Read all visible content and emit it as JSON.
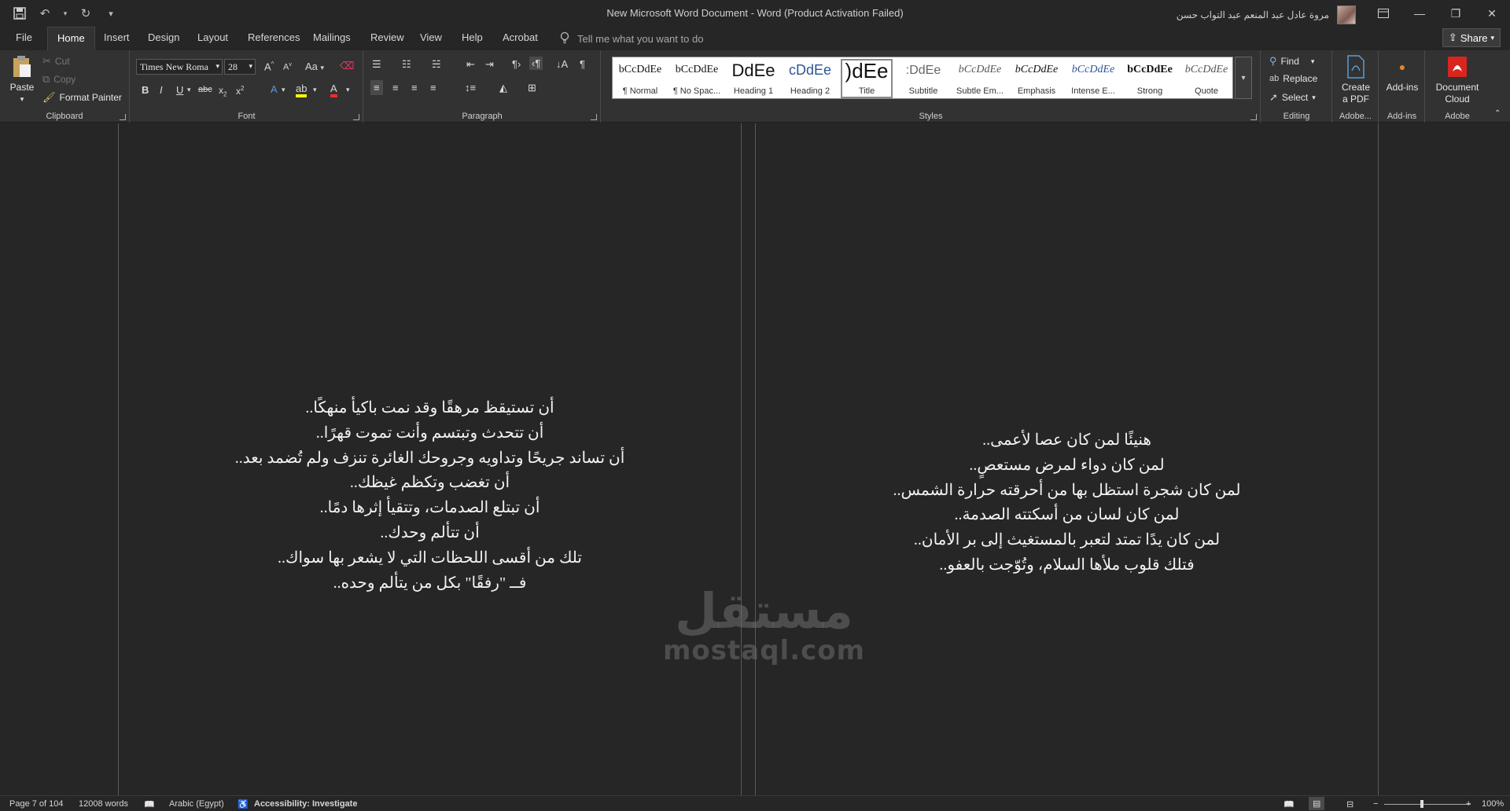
{
  "window": {
    "title": "New Microsoft Word Document  -  Word (Product Activation Failed)",
    "user_name": "مروة عادل عبد المنعم عبد التواب حسن"
  },
  "quick_access": {
    "save_icon": "save-icon",
    "undo_icon": "undo-icon",
    "redo_icon": "redo-icon",
    "customize_icon": "customize-icon"
  },
  "tabs": [
    "File",
    "Home",
    "Insert",
    "Design",
    "Layout",
    "References",
    "Mailings",
    "Review",
    "View",
    "Help",
    "Acrobat"
  ],
  "active_tab": "Home",
  "tell_me": "Tell me what you want to do",
  "share_label": "Share",
  "clipboard": {
    "paste": "Paste",
    "cut": "Cut",
    "copy": "Copy",
    "format_painter": "Format Painter",
    "label": "Clipboard"
  },
  "font": {
    "name": "Times New Roma",
    "size": "28",
    "change_case": "Aa",
    "label": "Font"
  },
  "paragraph": {
    "label": "Paragraph"
  },
  "styles": {
    "label": "Styles",
    "items": [
      {
        "preview": "bCcDdEe",
        "name": "¶ Normal"
      },
      {
        "preview": "bCcDdEe",
        "name": "¶ No Spac..."
      },
      {
        "preview": "DdEe",
        "name": "Heading 1"
      },
      {
        "preview": "cDdEe",
        "name": "Heading 2"
      },
      {
        "preview": ")dEe",
        "name": "Title"
      },
      {
        "preview": ":DdEe",
        "name": "Subtitle"
      },
      {
        "preview": "bCcDdEe",
        "name": "Subtle Em..."
      },
      {
        "preview": "bCcDdEe",
        "name": "Emphasis"
      },
      {
        "preview": "bCcDdEe",
        "name": "Intense E..."
      },
      {
        "preview": "bCcDdEe",
        "name": "Strong"
      },
      {
        "preview": "bCcDdEe",
        "name": "Quote"
      }
    ]
  },
  "editing": {
    "find": "Find",
    "replace": "Replace",
    "select": "Select",
    "label": "Editing"
  },
  "adobe": {
    "create_pdf_line1": "Create",
    "create_pdf_line2": "a PDF",
    "label": "Adobe..."
  },
  "addins": {
    "button": "Add-ins",
    "label": "Add-ins"
  },
  "doc_cloud": {
    "line1": "Document",
    "line2": "Cloud",
    "label": "Adobe"
  },
  "left_page": {
    "lines": [
      "أن تستيقظ مرهقًا وقد نمت باكيأ منهكًا..",
      "أن تتحدث وتبتسم وأنت تموت قهرًا..",
      "أن تساند جريحًا وتداويه وجروحك الغائرة تنزف ولم تُضمد بعد..",
      "أن تغضب وتكظم غيظك..",
      "أن تبتلع الصدمات، وتتقيأ إثرها دمًا..",
      "أن تتألم وحدك..",
      "تلك من أقسى اللحظات التي لا يشعر بها سواك..",
      "فــ \"رفقًا\" بكل من يتألم وحده.."
    ]
  },
  "right_page": {
    "lines": [
      "هنيئًا لمن كان عصا لأعمى..",
      "لمن كان دواء لمرض مستعصٍ..",
      "لمن كان شجرة استظل بها من أحرقته حرارة الشمس..",
      "لمن كان لسان من أسكتته الصدمة..",
      "لمن كان يدًا تمتد لتعبر بالمستغيث إلى بر الأمان..",
      "فتلك قلوب ملأها السلام، وتُوّجت بالعفو.."
    ]
  },
  "watermark": {
    "arabic": "مستقل",
    "latin": "mostaql.com"
  },
  "status": {
    "page": "Page 7 of 104",
    "words": "12008 words",
    "language": "Arabic (Egypt)",
    "accessibility": "Accessibility: Investigate",
    "zoom": "100%"
  }
}
